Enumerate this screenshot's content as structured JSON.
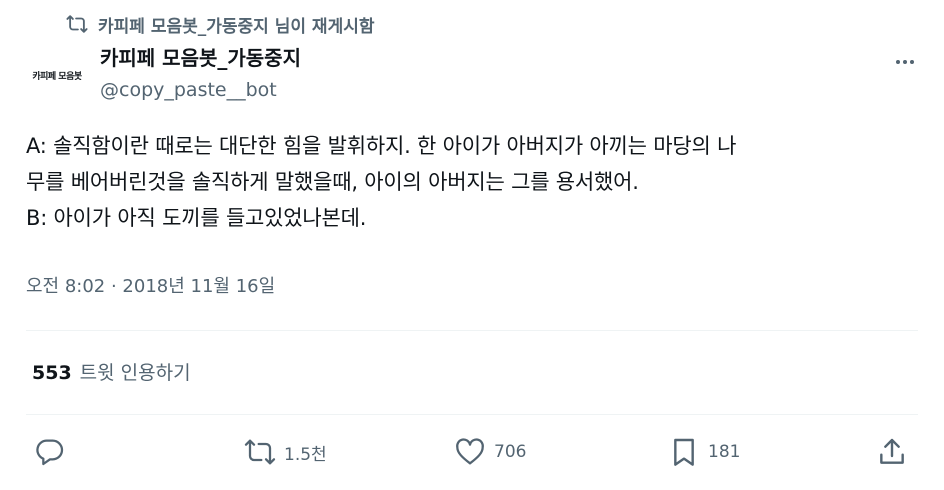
{
  "retweet_context": {
    "text": "카피페 모음봇_가동중지 님이 재게시함"
  },
  "author": {
    "avatar_text": "카피페 모음봇",
    "display_name": "카피페 모음봇_가동중지",
    "handle": "@copy_paste__bot"
  },
  "tweet": {
    "lines": [
      "A: 솔직함이란 때로는 대단한 힘을 발휘하지. 한 아이가 아버지가 아끼는 마당의 나",
      "무를 베어버린것을 솔직하게 말했을때, 아이의 아버지는 그를 용서했어.",
      "B: 아이가 아직 도끼를 들고있었나본데."
    ],
    "timestamp": "오전 8:02 · 2018년 11월 16일"
  },
  "quote_stats": {
    "count": "553",
    "label": "트윗 인용하기"
  },
  "actions": {
    "reply": {
      "icon": "reply-icon",
      "count": ""
    },
    "retweet": {
      "icon": "retweet-icon",
      "count": "1.5천"
    },
    "like": {
      "icon": "heart-icon",
      "count": "706"
    },
    "bookmark": {
      "icon": "bookmark-icon",
      "count": "181"
    },
    "share": {
      "icon": "share-icon",
      "count": ""
    }
  },
  "colors": {
    "text_primary": "#0f1419",
    "text_secondary": "#536471",
    "divider": "#eff3f4"
  }
}
